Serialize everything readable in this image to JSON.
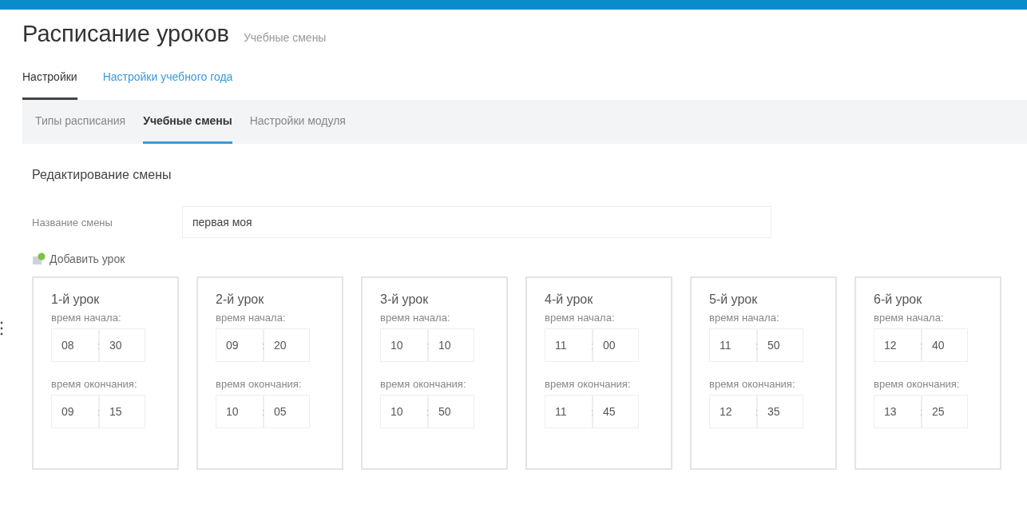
{
  "header": {
    "title": "Расписание уроков",
    "subtitle": "Учебные смены"
  },
  "tabs": [
    {
      "label": "Настройки",
      "selected": true
    },
    {
      "label": "Настройки учебного года",
      "selected": false
    }
  ],
  "subtabs": [
    {
      "label": "Типы расписания",
      "selected": false
    },
    {
      "label": "Учебные смены",
      "selected": true
    },
    {
      "label": "Настройки модуля",
      "selected": false
    }
  ],
  "form": {
    "heading": "Редактирование смены",
    "name_label": "Название смены",
    "name_value": "первая моя",
    "add_lesson": "Добавить урок"
  },
  "lessons": [
    {
      "title": "1-й урок",
      "start_label": "время начала:",
      "start": {
        "hour": "08",
        "separator": ":",
        "minute": "30"
      },
      "end_label": "время окончания:",
      "end": {
        "hour": "09",
        "separator": ":",
        "minute": "15"
      }
    },
    {
      "title": "2-й урок",
      "start_label": "время начала:",
      "start": {
        "hour": "09",
        "separator": ":",
        "minute": "20"
      },
      "end_label": "время окончания:",
      "end": {
        "hour": "10",
        "separator": ":",
        "minute": "05"
      }
    },
    {
      "title": "3-й урок",
      "start_label": "время начала:",
      "start": {
        "hour": "10",
        "separator": ":",
        "minute": "10"
      },
      "end_label": "время окончания:",
      "end": {
        "hour": "10",
        "separator": ":",
        "minute": "50"
      }
    },
    {
      "title": "4-й урок",
      "start_label": "время начала:",
      "start": {
        "hour": "11",
        "separator": ":",
        "minute": "00"
      },
      "end_label": "время окончания:",
      "end": {
        "hour": "11",
        "separator": ":",
        "minute": "45"
      }
    },
    {
      "title": "5-й урок",
      "start_label": "время начала:",
      "start": {
        "hour": "11",
        "separator": ":",
        "minute": "50"
      },
      "end_label": "время окончания:",
      "end": {
        "hour": "12",
        "separator": ":",
        "minute": "35"
      }
    },
    {
      "title": "6-й урок",
      "start_label": "время начала:",
      "start": {
        "hour": "12",
        "separator": ":",
        "minute": "40"
      },
      "end_label": "время окончания:",
      "end": {
        "hour": "13",
        "separator": ":",
        "minute": "25"
      }
    }
  ]
}
